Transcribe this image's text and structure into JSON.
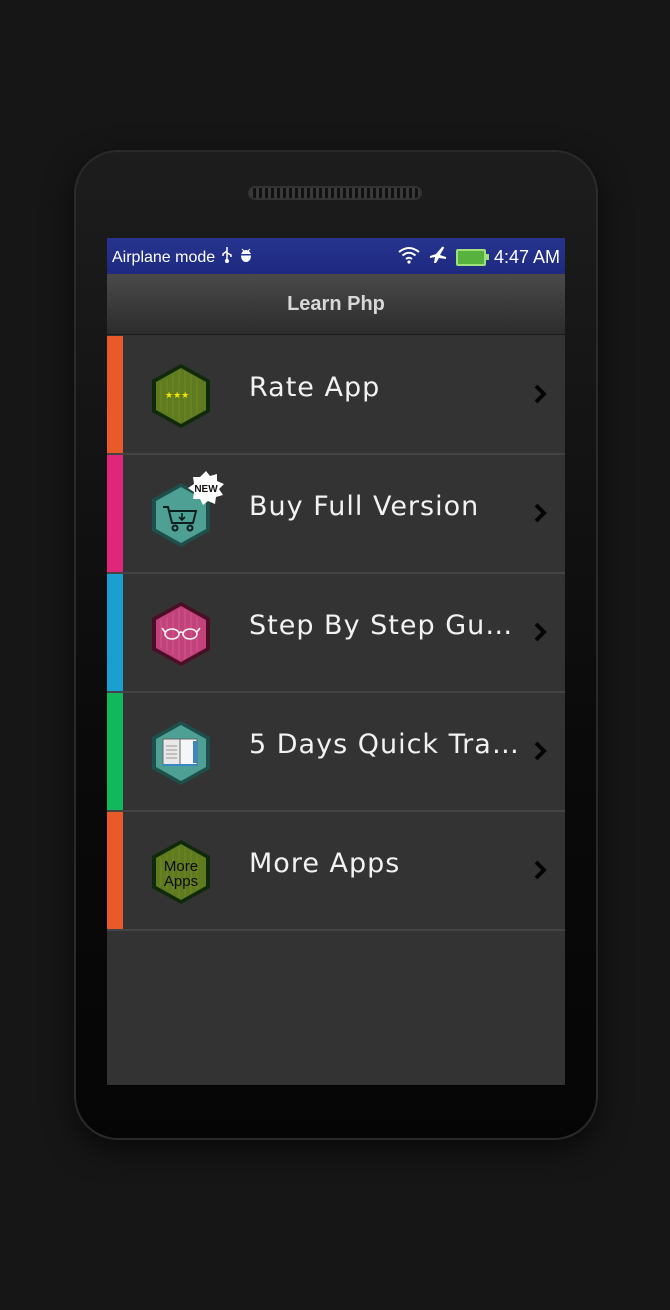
{
  "statusbar": {
    "left_text": "Airplane mode",
    "time": "4:47 AM",
    "icons": [
      "usb-icon",
      "android-debug-icon",
      "wifi-icon",
      "airplane-icon",
      "battery-charging-icon"
    ]
  },
  "actionbar": {
    "title": "Learn Php"
  },
  "menu": {
    "items": [
      {
        "label": "Rate App",
        "accent": "#e85a2a",
        "icon": "rate-stars-icon",
        "icon_color": "#5f7a1f"
      },
      {
        "label": "Buy Full Version",
        "accent": "#e0267a",
        "icon": "cart-icon",
        "icon_color": "#4e9f94",
        "badge": "NEW"
      },
      {
        "label": "Step By Step Gui…",
        "accent": "#1aa0d0",
        "icon": "glasses-icon",
        "icon_color": "#c2427b"
      },
      {
        "label": "5 Days Quick Tra…",
        "accent": "#14b85c",
        "icon": "book-icon",
        "icon_color": "#4e9f94"
      },
      {
        "label": "More Apps",
        "accent": "#e85a2a",
        "icon": "more-apps-icon",
        "icon_color": "#5f7a1f",
        "icon_text_1": "More",
        "icon_text_2": "Apps"
      }
    ]
  }
}
